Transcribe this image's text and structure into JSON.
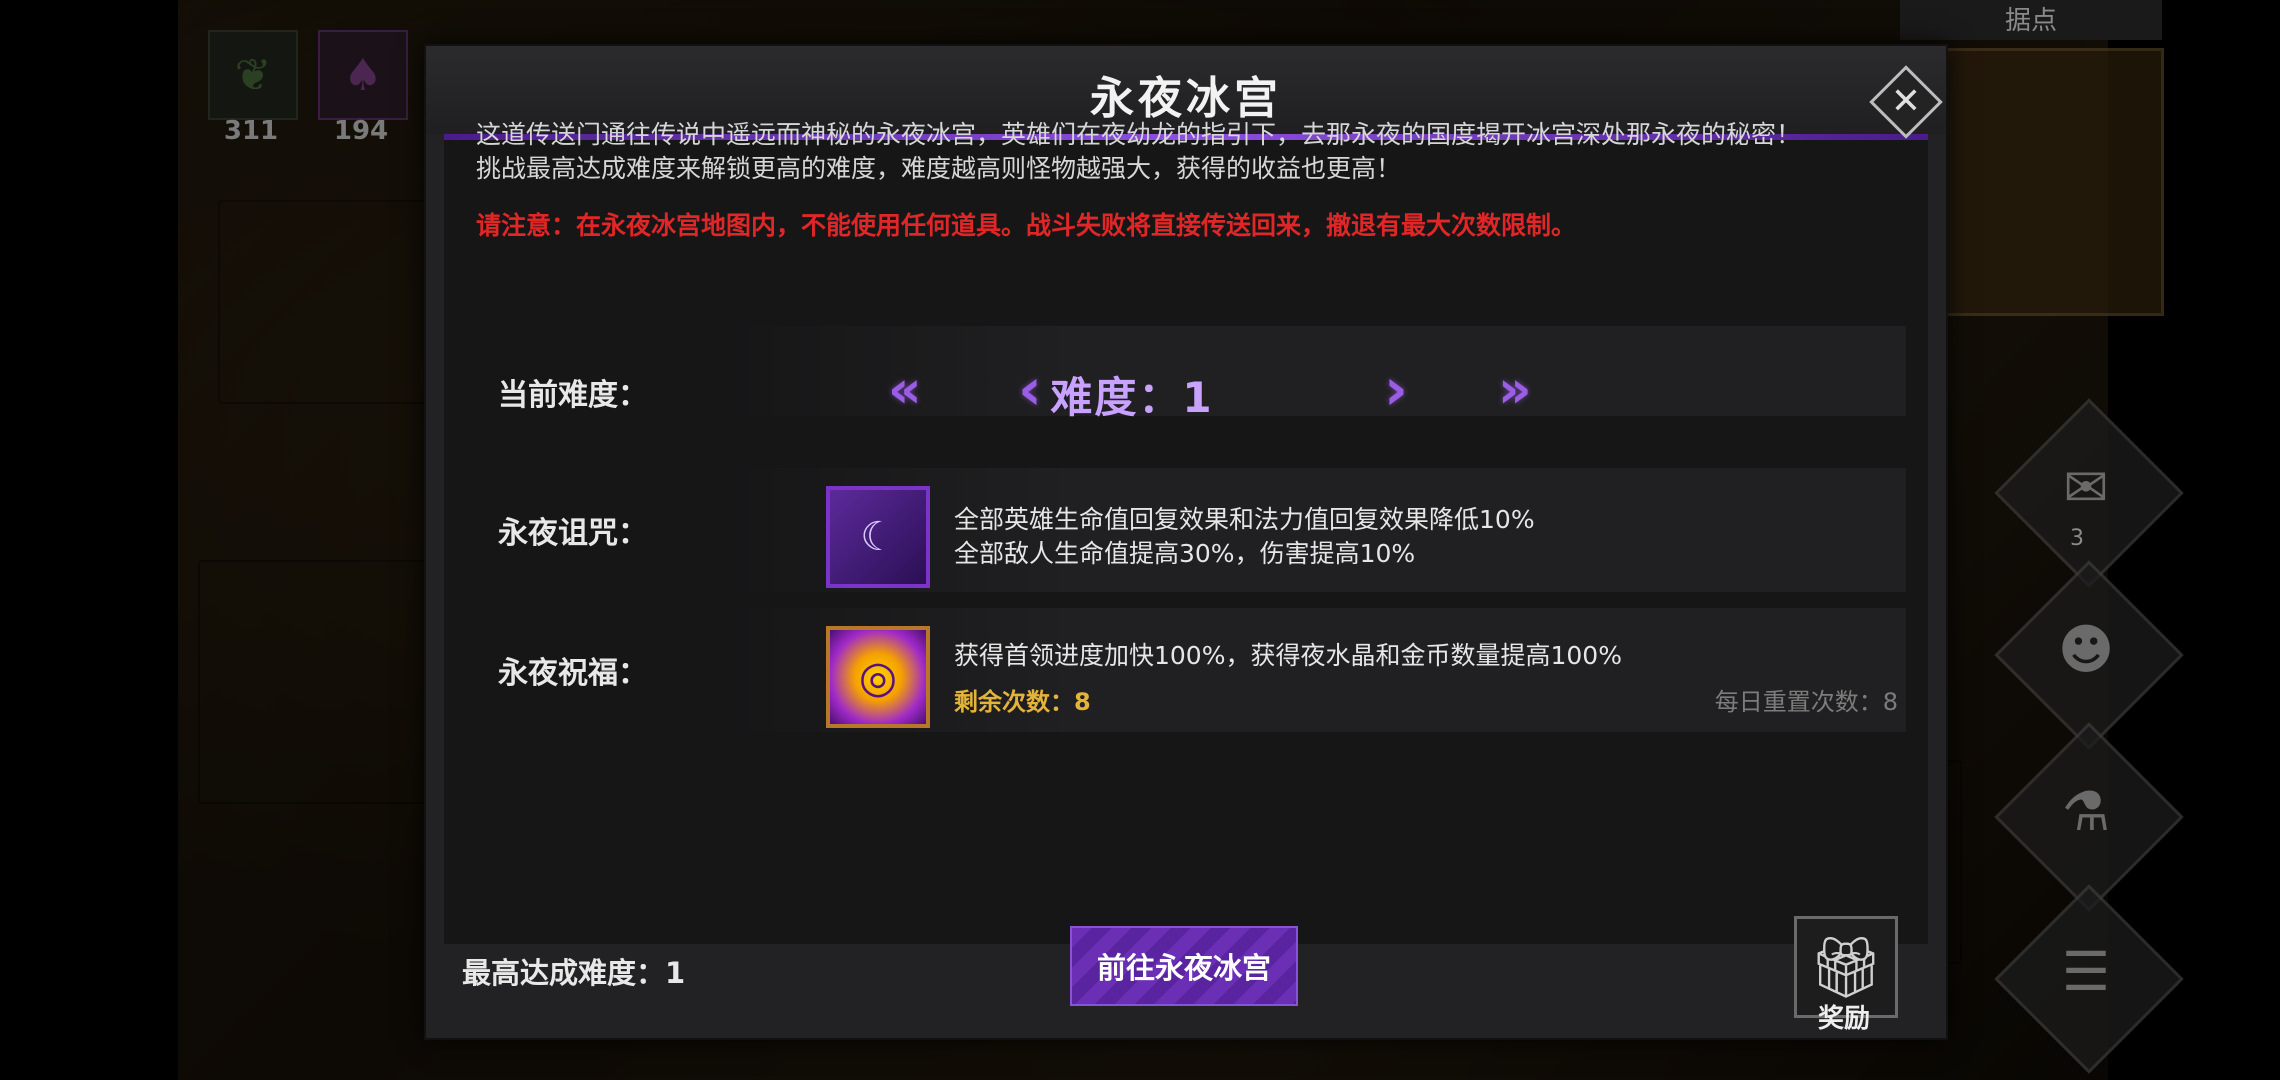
{
  "background": {
    "resources": [
      {
        "icon": "herb-icon",
        "count": "311"
      },
      {
        "icon": "potion-icon",
        "count": "194"
      }
    ],
    "minimap_title": "据点",
    "side_menu": [
      {
        "icon": "scroll-icon",
        "badge": "3"
      },
      {
        "icon": "heroes-icon"
      },
      {
        "icon": "flask-icon"
      },
      {
        "icon": "list-icon"
      }
    ]
  },
  "dialog": {
    "title": "永夜冰宫",
    "close_icon": "close-icon",
    "description_line1": "这道传送门通往传说中遥远而神秘的永夜冰宫，英雄们在夜幼龙的指引下，去那永夜的国度揭开冰宫深处那永夜的秘密！",
    "description_line2": "挑战最高达成难度来解锁更高的难度，难度越高则怪物越强大，获得的收益也更高！",
    "warning": "请注意：在永夜冰宫地图内，不能使用任何道具。战斗失败将直接传送回来，撤退有最大次数限制。",
    "difficulty": {
      "label": "当前难度：",
      "value_text": "难度：1",
      "first_icon": "«",
      "prev_icon": "‹",
      "next_icon": "›",
      "last_icon": "»"
    },
    "curse": {
      "label": "永夜诅咒：",
      "icon": "night-curse-icon",
      "line1": "全部英雄生命值回复效果和法力值回复效果降低10%",
      "line2": "全部敌人生命值提高30%，伤害提高10%"
    },
    "blessing": {
      "label": "永夜祝福：",
      "icon": "vortex-blessing-icon",
      "line1": "获得首领进度加快100%，获得夜水晶和金币数量提高100%",
      "remaining": "剩余次数：8",
      "daily_reset": "每日重置次数：8"
    },
    "footer": {
      "highest_difficulty": "最高达成难度：1",
      "go_button": "前往永夜冰宫",
      "reward_label": "奖励",
      "reward_icon": "gift-icon"
    }
  },
  "colors": {
    "accent_purple": "#9b5de5",
    "warning_red": "#e02626",
    "remaining_gold": "#e4b33a"
  }
}
